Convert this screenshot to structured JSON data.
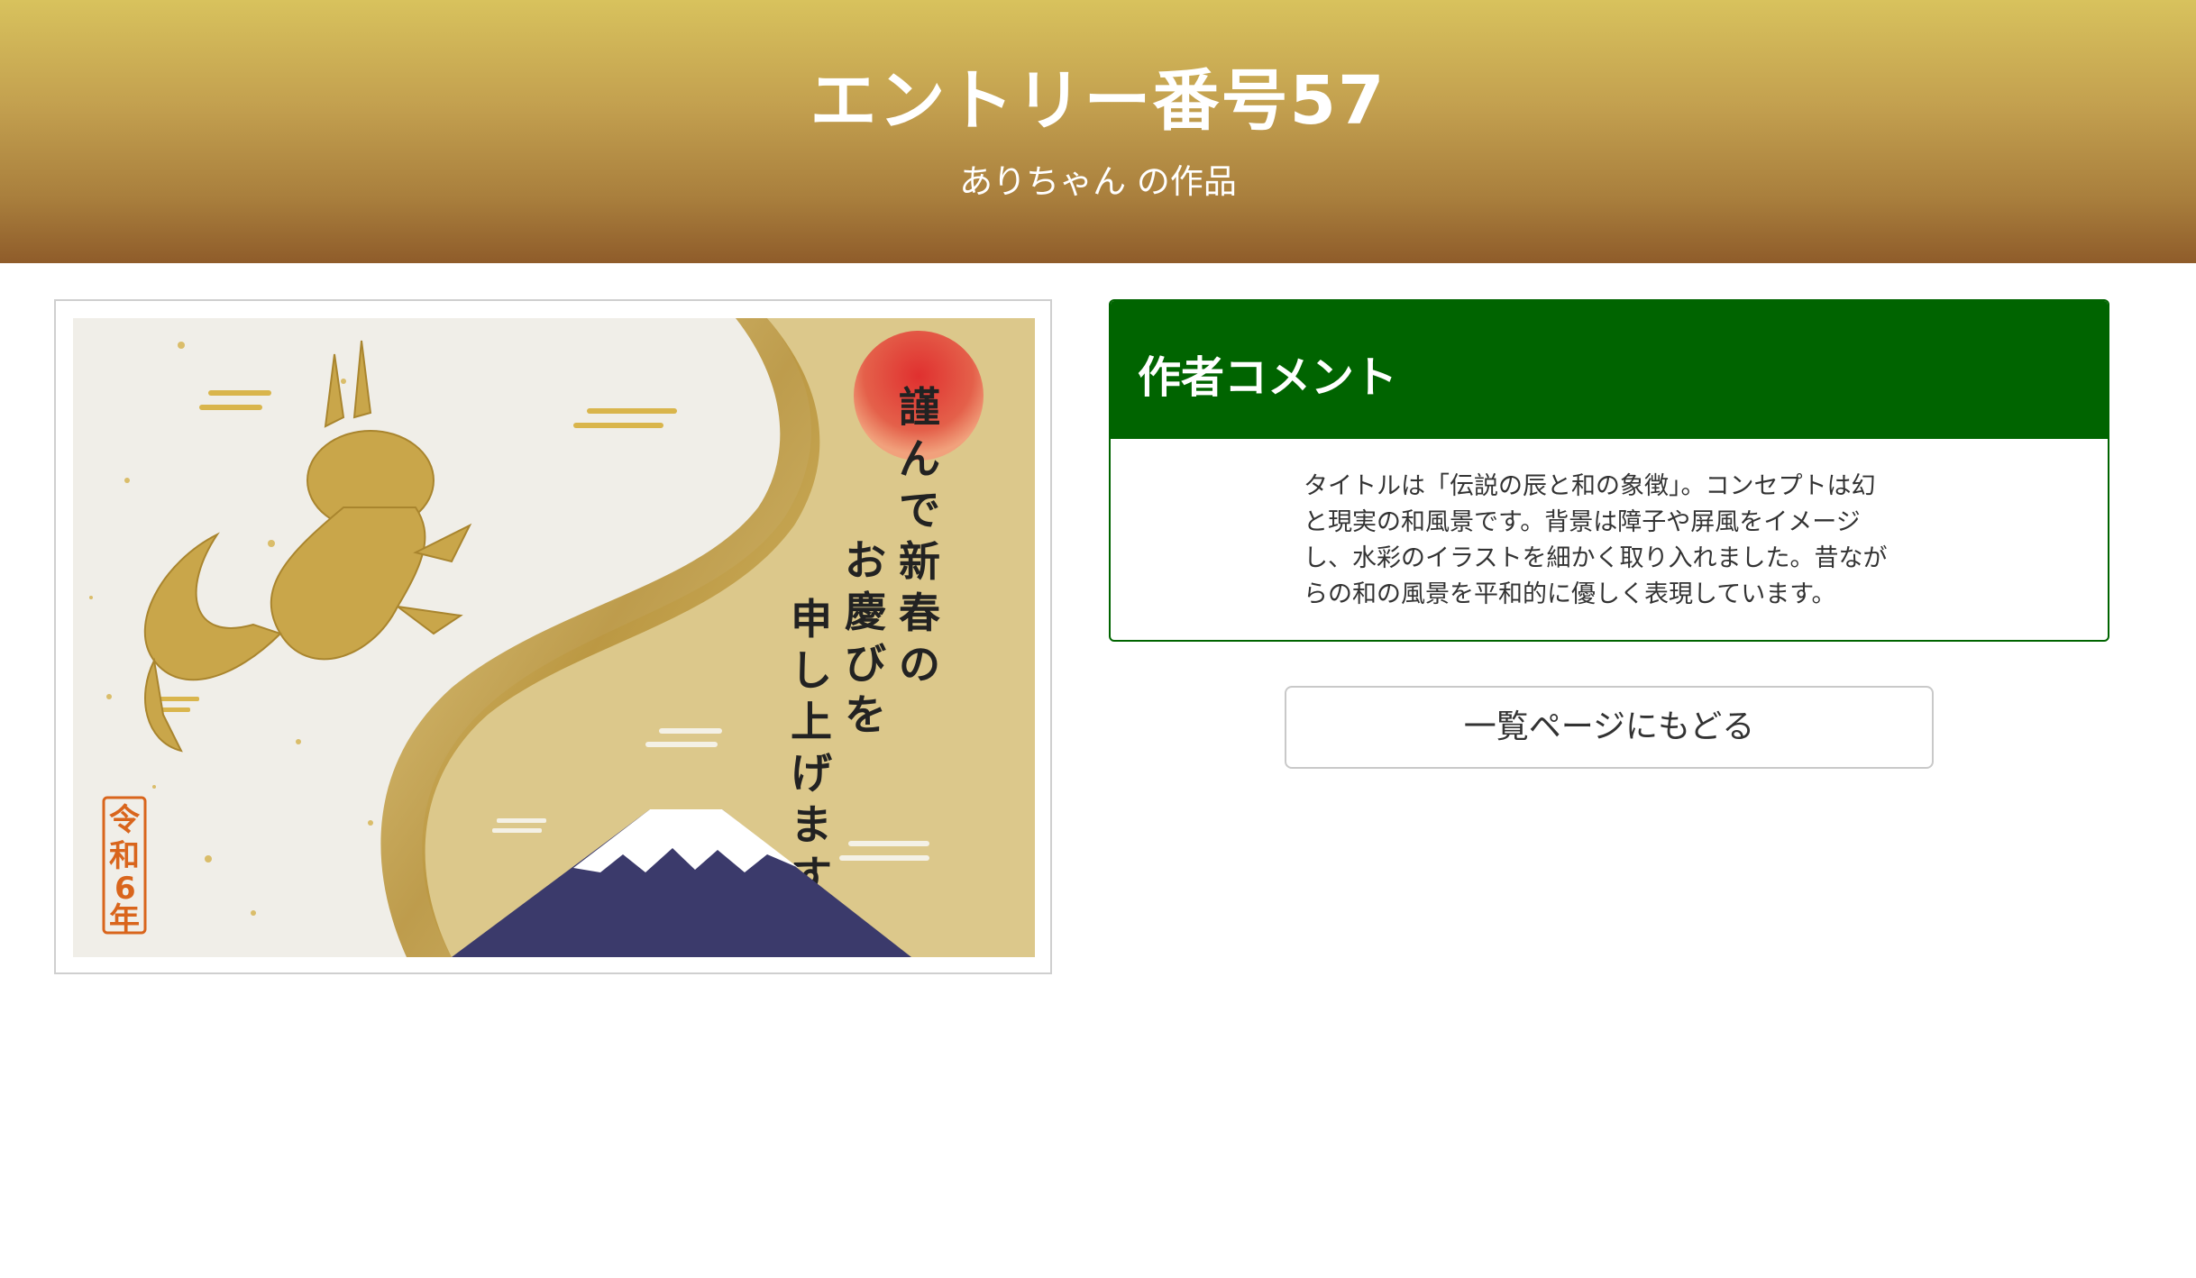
{
  "header": {
    "title": "エントリー番号57",
    "subtitle": "ありちゃん の作品"
  },
  "artwork": {
    "greeting": "謹んで新春のお慶びを申し上げます",
    "year_stamp": "令和6年",
    "colors": {
      "paper": "#f1efe9",
      "gold": "#c9a84a",
      "sun": "#d7262e",
      "mountain": "#3b3a6b",
      "snow": "#ffffff",
      "stamp": "#d9651c"
    }
  },
  "comment": {
    "heading": "作者コメント",
    "lines": [
      "タイトルは「伝説の辰と和の象徴」。コンセプトは幻",
      "と現実の和風景です。背景は障子や屏風をイメージ",
      "し、水彩のイラストを細かく取り入れました。昔なが",
      "らの和の風景を平和的に優しく表現しています。"
    ]
  },
  "back_button": {
    "label": "一覧ページにもどる"
  },
  "colors": {
    "header_top": "#d8c25d",
    "header_bottom": "#8f5c2a",
    "comment_accent": "#006400"
  }
}
